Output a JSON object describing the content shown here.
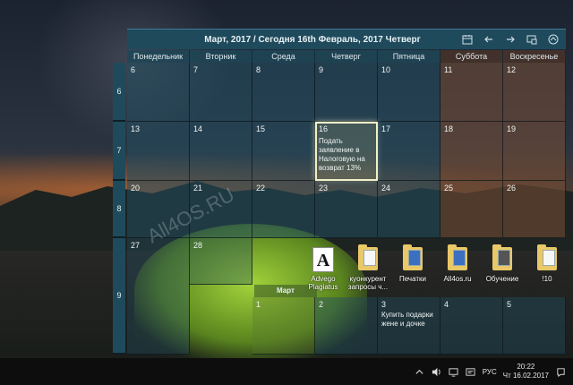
{
  "header": {
    "title": "Март, 2017 / Сегодня 16th Февраль, 2017 Четверг"
  },
  "day_headers": [
    "Понедельник",
    "Вторник",
    "Среда",
    "Четверг",
    "Пятница",
    "Суббота",
    "Воскресенье"
  ],
  "weeks": [
    {
      "num": "6",
      "days": [
        {
          "n": "6",
          "event": ""
        },
        {
          "n": "7",
          "event": ""
        },
        {
          "n": "8",
          "event": ""
        },
        {
          "n": "9",
          "event": ""
        },
        {
          "n": "10",
          "event": ""
        },
        {
          "n": "11",
          "event": ""
        },
        {
          "n": "12",
          "event": ""
        }
      ]
    },
    {
      "num": "7",
      "days": [
        {
          "n": "13",
          "event": ""
        },
        {
          "n": "14",
          "event": ""
        },
        {
          "n": "15",
          "event": ""
        },
        {
          "n": "16",
          "event": "Подать заявление в Налоговую на возврат 13%"
        },
        {
          "n": "17",
          "event": ""
        },
        {
          "n": "18",
          "event": ""
        },
        {
          "n": "19",
          "event": ""
        }
      ]
    },
    {
      "num": "8",
      "days": [
        {
          "n": "20",
          "event": ""
        },
        {
          "n": "21",
          "event": ""
        },
        {
          "n": "22",
          "event": ""
        },
        {
          "n": "23",
          "event": ""
        },
        {
          "n": "24",
          "event": ""
        },
        {
          "n": "25",
          "event": ""
        },
        {
          "n": "26",
          "event": ""
        }
      ]
    },
    {
      "num": "9",
      "days": [
        {
          "n": "27",
          "event": ""
        },
        {
          "n": "28",
          "event": ""
        },
        {
          "n": "",
          "event": ""
        },
        {
          "n": "",
          "event": ""
        },
        {
          "n": "",
          "event": ""
        },
        {
          "n": "",
          "event": ""
        },
        {
          "n": "",
          "event": ""
        }
      ]
    }
  ],
  "next_month": {
    "label": "Март",
    "days": [
      {
        "n": "1",
        "event": ""
      },
      {
        "n": "2",
        "event": ""
      },
      {
        "n": "3",
        "event": "Купить подарки жене и дочке"
      },
      {
        "n": "4",
        "event": ""
      },
      {
        "n": "5",
        "event": ""
      }
    ]
  },
  "desktop_icons": [
    {
      "label": "Advego\nPlagiatus",
      "icon": "app-icon"
    },
    {
      "label": "куонкурент\nзапросы ч...",
      "icon": "folder-icon"
    },
    {
      "label": "Печатки",
      "icon": "folder-icon"
    },
    {
      "label": "All4os.ru",
      "icon": "folder-icon"
    },
    {
      "label": "Обучение",
      "icon": "folder-icon"
    },
    {
      "label": "!10",
      "icon": "folder-icon"
    }
  ],
  "taskbar": {
    "lang": "РУС",
    "time": "20:22",
    "date": "Чт 16.02.2017"
  },
  "watermark": "All4OS.RU",
  "colors": {
    "accent": "#1f4a5c",
    "weekend": "#784e34",
    "today_outline": "#f2f0c8"
  }
}
